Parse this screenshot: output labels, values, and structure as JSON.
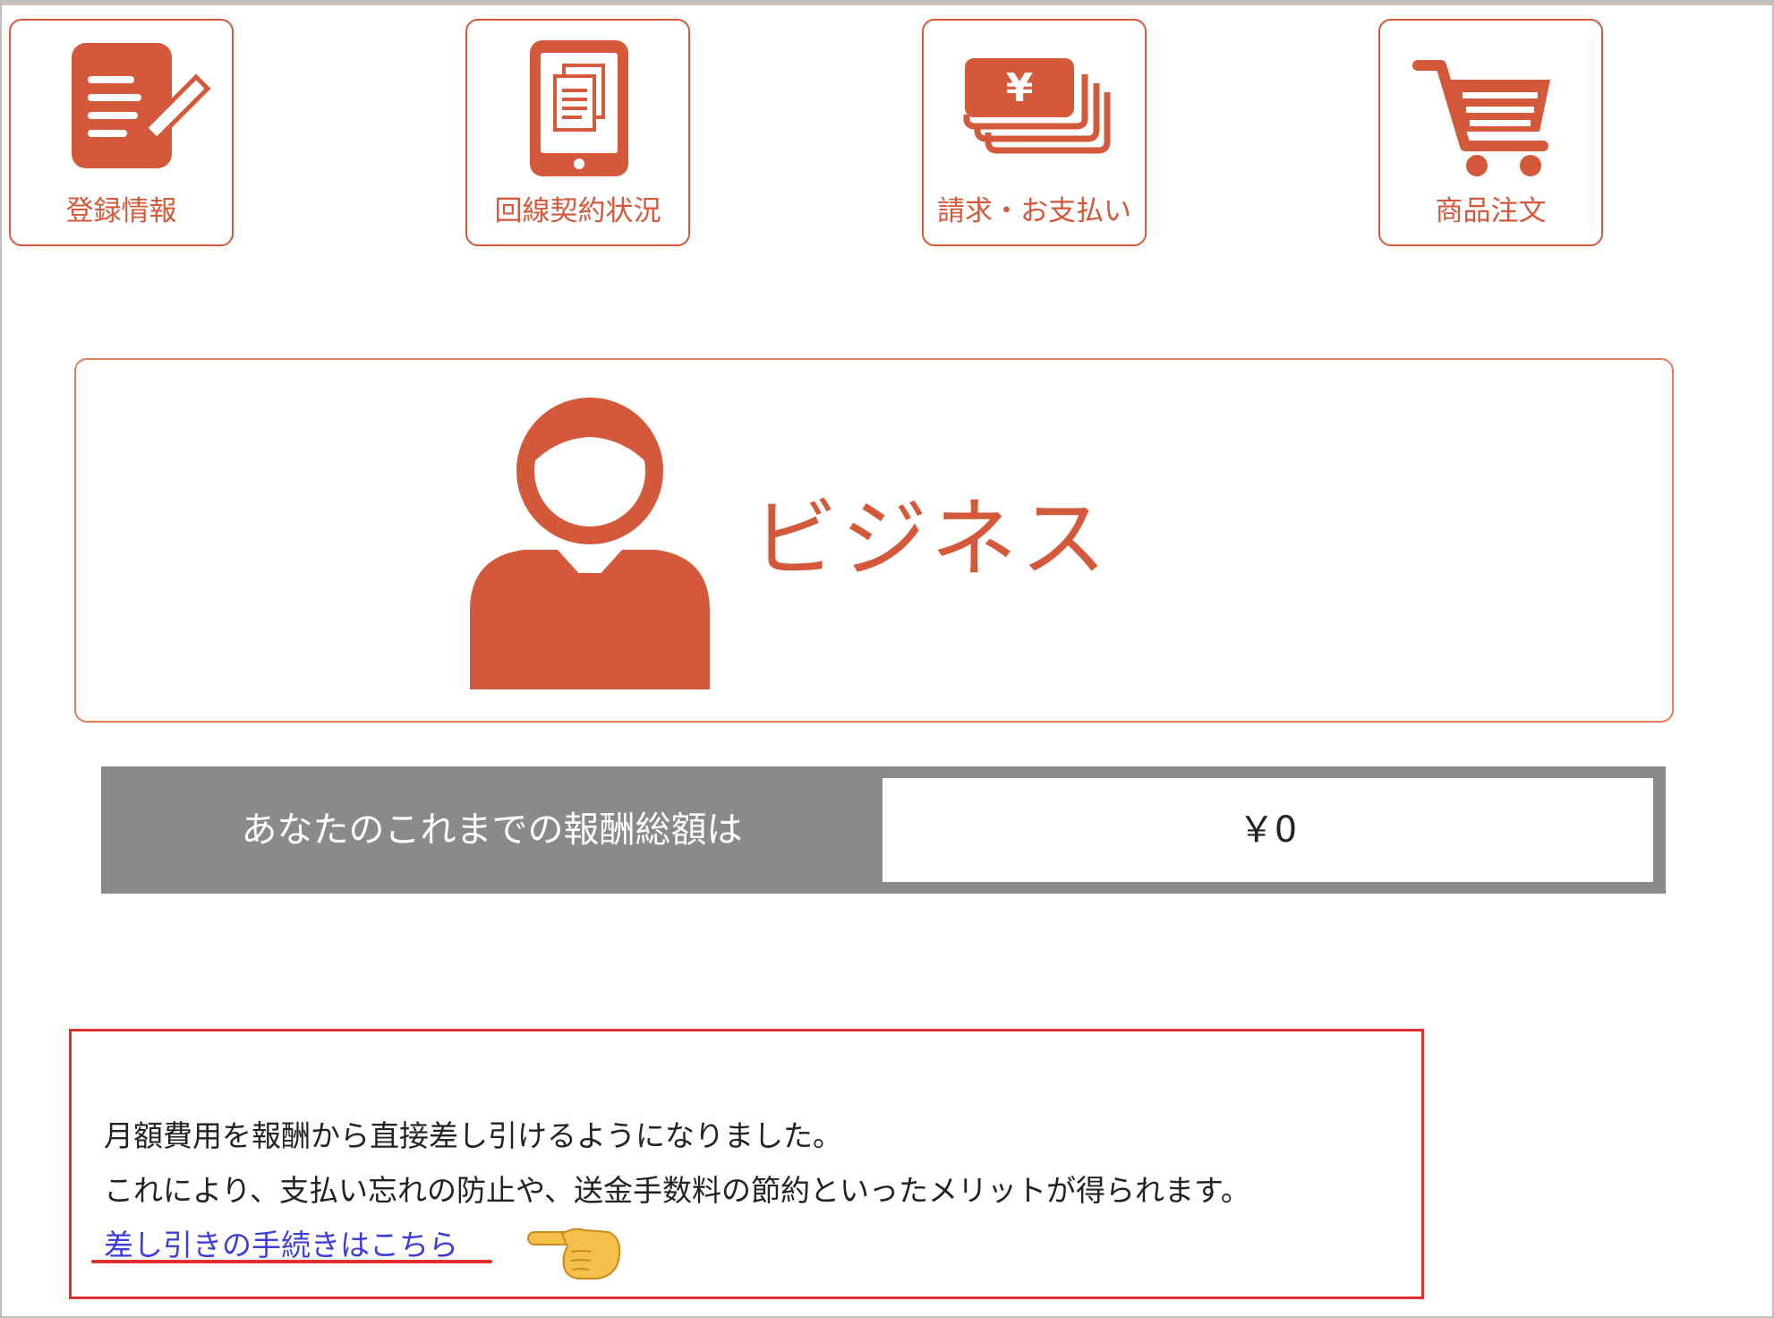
{
  "colors": {
    "accent": "#d4583a",
    "gray_band": "#8a8a8a",
    "highlight_red": "#e03030",
    "link_blue": "#3d3dd8"
  },
  "nav": {
    "tiles": [
      {
        "label": "登録情報",
        "icon": "registration-edit-icon"
      },
      {
        "label": "回線契約状況",
        "icon": "tablet-documents-icon"
      },
      {
        "label": "請求・お支払い",
        "icon": "yen-bills-icon"
      },
      {
        "label": "商品注文",
        "icon": "shopping-cart-icon"
      }
    ]
  },
  "profile": {
    "membership": "ビジネス",
    "icon": "business-person-icon"
  },
  "reward": {
    "label": "あなたのこれまでの報酬総額は",
    "value": "￥0"
  },
  "notice": {
    "line1": "月額費用を報酬から直接差し引けるようになりました。",
    "line2": "これにより、支払い忘れの防止や、送金手数料の節約といったメリットが得られます。",
    "link": "差し引きの手続きはこちら",
    "pointer_icon": "pointing-hand-icon"
  }
}
